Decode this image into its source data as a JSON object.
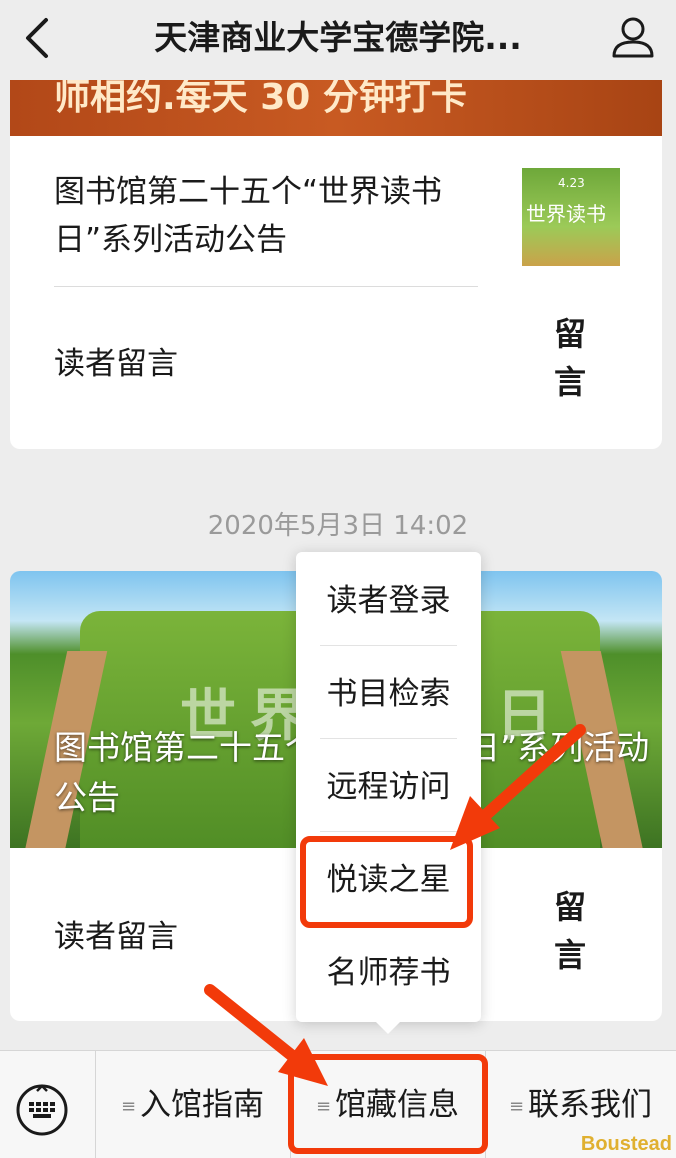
{
  "nav": {
    "title": "天津商业大学宝德学院..."
  },
  "card1": {
    "banner_text": "师相约.每天 30 分钟打卡",
    "article_title": "图书馆第二十五个“世界读书日”系列活动公告",
    "thumb_text": "世界读书",
    "thumb_small": "4.23",
    "message_label": "读者留言",
    "message_chars": [
      "留",
      "言"
    ]
  },
  "timestamp": "2020年5月3日 14:02",
  "card2": {
    "image_words": [
      "世",
      "界",
      "日"
    ],
    "title": "图书馆第二十五个“世界读书日”系列活动公告",
    "message_label": "读者留言",
    "message_chars": [
      "留",
      "言"
    ]
  },
  "popup_menu": {
    "items": [
      "读者登录",
      "书目检索",
      "远程访问",
      "悦读之星",
      "名师荐书"
    ],
    "highlighted": "悦读之星"
  },
  "tabbar": {
    "keyboard_icon": "keyboard-icon",
    "menu_mark": "≡",
    "tabs": [
      "入馆指南",
      "馆藏信息",
      "联系我们"
    ],
    "highlighted_tab": "馆藏信息"
  },
  "annotation_color": "#f23a0a",
  "watermark": "Boustead"
}
